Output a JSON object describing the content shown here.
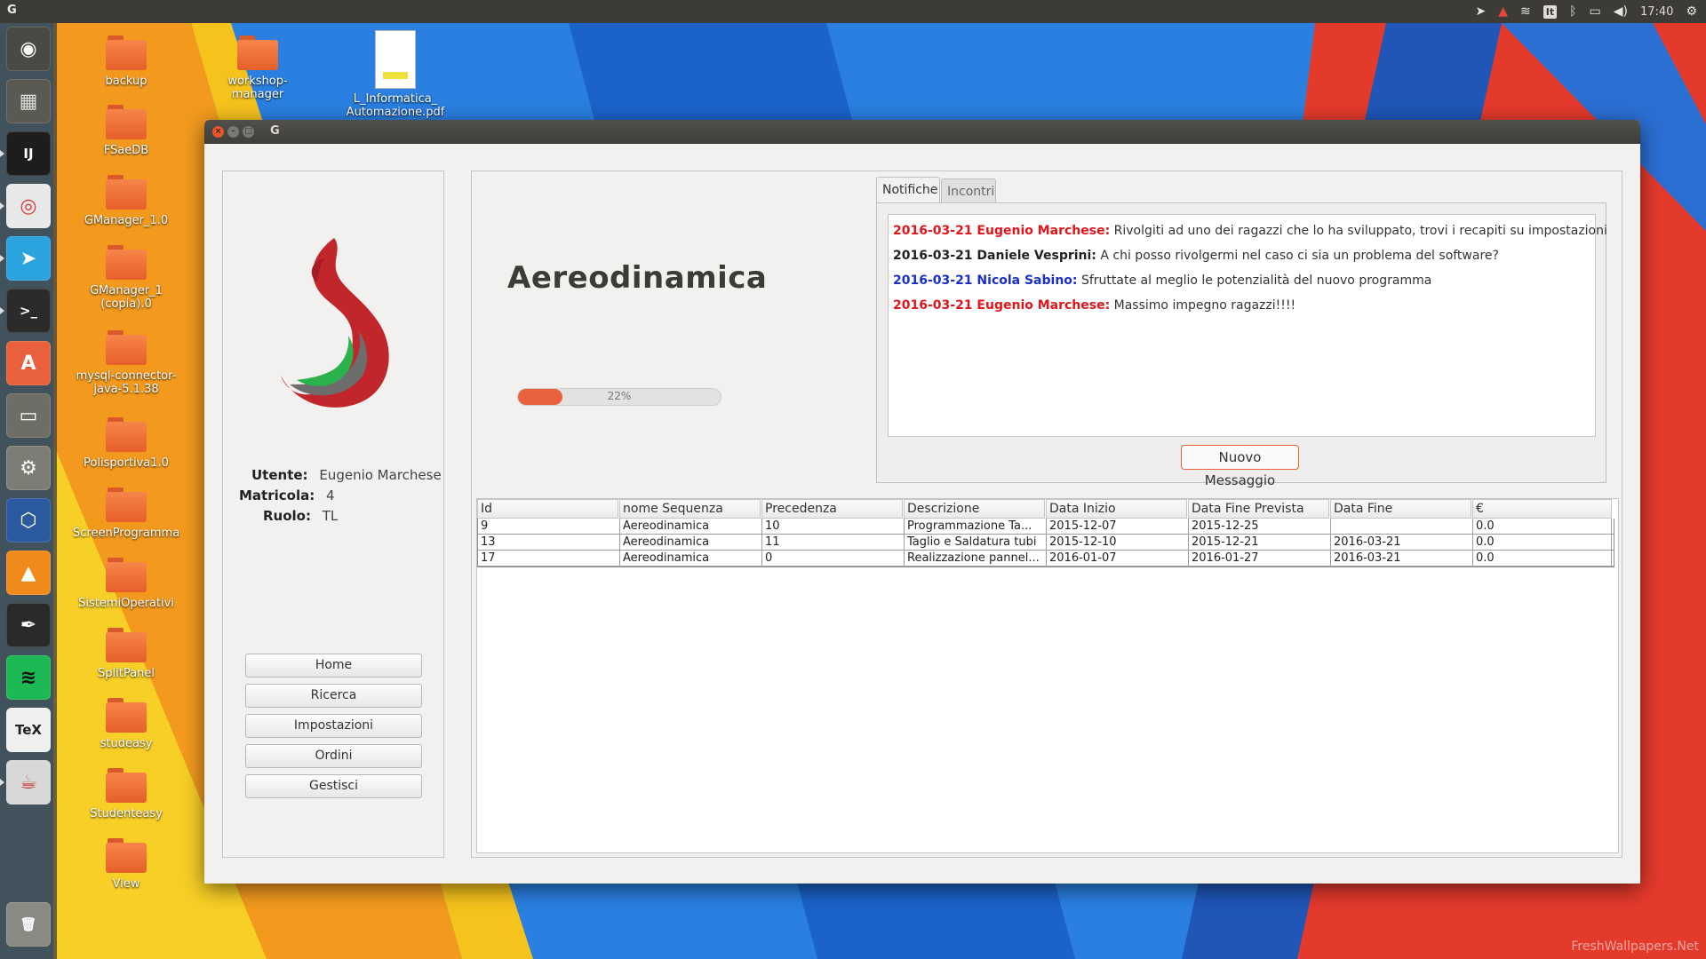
{
  "topbar": {
    "app_letter": "G",
    "keyboard_layout": "It",
    "clock": "17:40"
  },
  "launcher": [
    {
      "name": "ubuntu-dash-icon",
      "glyph": "◉"
    },
    {
      "name": "workspace-switcher-icon",
      "glyph": "▦"
    },
    {
      "name": "intellij-icon",
      "glyph": "IJ"
    },
    {
      "name": "chrome-icon",
      "glyph": "◎"
    },
    {
      "name": "telegram-icon",
      "glyph": "➤"
    },
    {
      "name": "terminal-icon",
      "glyph": ">_"
    },
    {
      "name": "software-center-icon",
      "glyph": "A"
    },
    {
      "name": "file-manager-icon",
      "glyph": "▭"
    },
    {
      "name": "system-settings-icon",
      "glyph": "⚙"
    },
    {
      "name": "virtualbox-icon",
      "glyph": "⬡"
    },
    {
      "name": "vlc-icon",
      "glyph": "▲"
    },
    {
      "name": "inkscape-icon",
      "glyph": "✒"
    },
    {
      "name": "spotify-icon",
      "glyph": "≋"
    },
    {
      "name": "tex-icon",
      "glyph": "TeX"
    },
    {
      "name": "java-icon",
      "glyph": "☕"
    },
    {
      "name": "trash-icon",
      "glyph": "🗑"
    }
  ],
  "desktop": {
    "icons_col1": [
      "backup",
      "FSaeDB",
      "GManager_1.0",
      "GManager_1 (copia).0",
      "mysql-connector-java-5.1.38",
      "Polisportiva1.0",
      "ScreenProgramma",
      "SistemiOperativi",
      "SplitPanel",
      "studeasy",
      "Studenteasy",
      "View"
    ],
    "workshop": "workshop-manager",
    "pdf_line1": "L_Informatica_",
    "pdf_line2": "Automazione.pdf",
    "watermark": "FreshWallpapers.Net"
  },
  "window": {
    "title": "G",
    "user": {
      "utente_label": "Utente:",
      "utente": "Eugenio Marchese",
      "matricola_label": "Matricola:",
      "matricola": "4",
      "ruolo_label": "Ruolo:",
      "ruolo": "TL"
    },
    "nav": [
      "Home",
      "Ricerca",
      "Impostazioni",
      "Ordini",
      "Gestisci"
    ],
    "project_title": "Aereodinamica",
    "progress": {
      "value": 22,
      "label": "22%"
    },
    "tabs": [
      "Notifiche",
      "Incontri"
    ],
    "messages": [
      {
        "author": "2016-03-21 Eugenio Marchese:",
        "text": "Rivolgiti ad uno dei ragazzi che lo ha sviluppato, trovi i recapiti su impostazioni",
        "color": "#e0161c"
      },
      {
        "author": "2016-03-21 Daniele Vesprini:",
        "text": "A chi posso rivolgermi nel caso ci sia un problema del software?",
        "color": "#222222"
      },
      {
        "author": "2016-03-21 Nicola Sabino:",
        "text": "Sfruttate al meglio le potenzialità del nuovo programma",
        "color": "#1a2fc9"
      },
      {
        "author": "2016-03-21 Eugenio Marchese:",
        "text": "Massimo impegno ragazzi!!!!",
        "color": "#e0161c"
      }
    ],
    "new_message_button": "Nuovo Messaggio",
    "table": {
      "columns": [
        "Id",
        "nome Sequenza",
        "Precedenza",
        "Descrizione",
        "Data Inizio",
        "Data Fine Prevista",
        "Data Fine",
        "€"
      ],
      "rows": [
        [
          "9",
          "Aereodinamica",
          "10",
          "Programmazione Ta...",
          "2015-12-07",
          "2015-12-25",
          "",
          "0.0"
        ],
        [
          "13",
          "Aereodinamica",
          "11",
          "Taglio e Saldatura tubi",
          "2015-12-10",
          "2015-12-21",
          "2016-03-21",
          "0.0"
        ],
        [
          "17",
          "Aereodinamica",
          "0",
          "Realizzazione pannel...",
          "2016-01-07",
          "2016-01-27",
          "2016-03-21",
          "0.0"
        ]
      ]
    }
  },
  "colors": {
    "accent": "#e8603c",
    "window_bg": "#f2f1f0",
    "titlebar": "#3c3b37"
  }
}
